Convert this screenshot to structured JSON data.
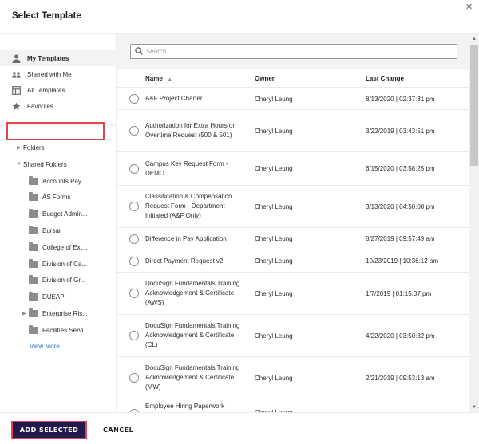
{
  "dialog": {
    "title": "Select Template",
    "close_icon": "close-icon"
  },
  "sidebar": {
    "nav": [
      {
        "label": "My Templates",
        "icon": "person-icon",
        "active": true
      },
      {
        "label": "Shared with Me",
        "icon": "people-icon",
        "active": false
      },
      {
        "label": "All Templates",
        "icon": "template-grid-icon",
        "active": false
      },
      {
        "label": "Favorites",
        "icon": "star-icon",
        "active": false
      }
    ],
    "folders_label": "Folders",
    "shared_folders_label": "Shared Folders",
    "shared_folders": [
      {
        "label": "Accounts Pay...",
        "has_children": false
      },
      {
        "label": "AS Forms",
        "has_children": false
      },
      {
        "label": "Budget Admin...",
        "has_children": false
      },
      {
        "label": "Bursar",
        "has_children": false
      },
      {
        "label": "College of Ext...",
        "has_children": false
      },
      {
        "label": "Division of Ca...",
        "has_children": false
      },
      {
        "label": "Division of Gr...",
        "has_children": false
      },
      {
        "label": "DUEAP",
        "has_children": false
      },
      {
        "label": "Enterprise Ris...",
        "has_children": true
      },
      {
        "label": "Facilities Servi...",
        "has_children": false
      }
    ],
    "view_more": "View More"
  },
  "search": {
    "placeholder": "Search",
    "value": ""
  },
  "table": {
    "columns": {
      "name": "Name",
      "owner": "Owner",
      "last_change": "Last Change"
    },
    "sort": {
      "column": "name",
      "direction": "ascending"
    },
    "rows": [
      {
        "name": "A&F Project Charter",
        "owner": "Cheryl Leung",
        "last_change": "8/13/2020 | 02:37:31 pm"
      },
      {
        "name": "Authorization for Extra Hours or Overtime Request (500 & 501)",
        "owner": "Cheryl Leung",
        "last_change": "3/22/2019 | 03:43:51 pm"
      },
      {
        "name": "Campus Key Request Form - DEMO",
        "owner": "Cheryl Leung",
        "last_change": "6/15/2020 | 03:58:25 pm"
      },
      {
        "name": "Classification & Compensation Request Form - Department Initiated (A&F Only)",
        "owner": "Cheryl Leung",
        "last_change": "3/13/2020 | 04:50:08 pm"
      },
      {
        "name": "Difference in Pay Application",
        "owner": "Cheryl Leung",
        "last_change": "8/27/2019 | 09:57:49 am"
      },
      {
        "name": "Direct Payment Request v2",
        "owner": "Cheryl Leung",
        "last_change": "10/23/2019 | 10:36:12 am"
      },
      {
        "name": "DocuSign Fundamentals Training Acknowledgement & Certificate (AWS)",
        "owner": "Cheryl Leung",
        "last_change": "1/7/2019 | 01:15:37 pm"
      },
      {
        "name": "DocuSign Fundamentals Training Acknowledgement & Certificate (CL)",
        "owner": "Cheryl Leung",
        "last_change": "4/22/2020 | 03:50:32 pm"
      },
      {
        "name": "DocuSign Fundamentals Training Acknowledgement & Certificate (MW)",
        "owner": "Cheryl Leung",
        "last_change": "2/21/2019 | 09:53:13 am"
      },
      {
        "name": "Employee Hiring Paperwork",
        "owner": "Cheryl Leung",
        "last_change": ""
      }
    ]
  },
  "footer": {
    "add_selected": "ADD SELECTED",
    "cancel": "CANCEL"
  },
  "colors": {
    "primary_button": "#23184e",
    "highlight_outline": "#e0474c",
    "link": "#2a6fd1"
  }
}
